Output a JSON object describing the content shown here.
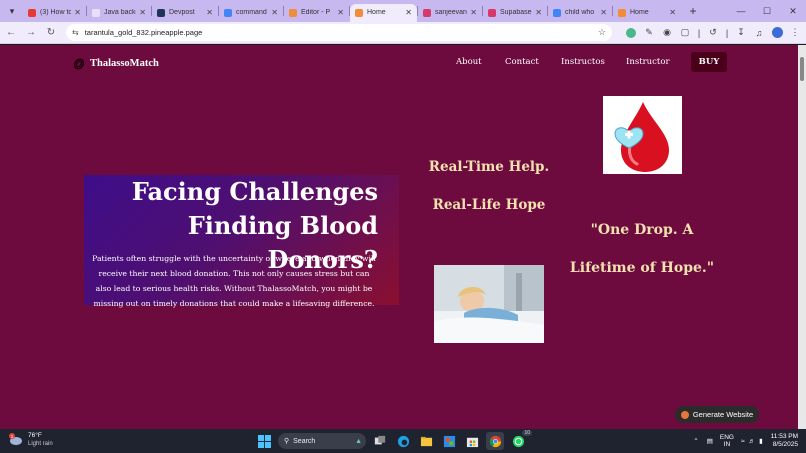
{
  "browser": {
    "tabs": [
      {
        "title": "(3) How to",
        "favicon_color": "#e53935",
        "active": false
      },
      {
        "title": "Java backe",
        "favicon_color": "#e8e0f8",
        "active": false
      },
      {
        "title": "Devpost",
        "favicon_color": "#1d3557",
        "active": false
      },
      {
        "title": "command",
        "favicon_color": "#4285f4",
        "active": false
      },
      {
        "title": "Editor - P",
        "favicon_color": "#f28c38",
        "active": false
      },
      {
        "title": "Home",
        "favicon_color": "#f28c38",
        "active": true
      },
      {
        "title": "sanjeevan",
        "favicon_color": "#d63a6a",
        "active": false
      },
      {
        "title": "Supabase",
        "favicon_color": "#d63a6a",
        "active": false
      },
      {
        "title": "child who",
        "favicon_color": "#4285f4",
        "active": false
      },
      {
        "title": "Home",
        "favicon_color": "#f28c38",
        "active": false
      }
    ],
    "url": "tarantula_gold_832.pineapple.page"
  },
  "site": {
    "brand": "ThalassoMatch",
    "nav": [
      "About",
      "Contact",
      "Instructos",
      "Instructor"
    ],
    "buy_label": "BUY",
    "hero_title": "Facing Challenges Finding Blood Donors?",
    "hero_text": "Patients often struggle with the uncertainty of where and when they will receive their next blood donation. This not only causes stress but can also lead to serious health risks. Without ThalassoMatch, you might be missing out on timely donations that could make a lifesaving difference.",
    "tagline_1": "Real-Time Help.",
    "tagline_2": "Real-Life Hope",
    "quote": "\"One Drop. A Lifetime of Hope.\"",
    "generate_label": "Generate Website",
    "colors": {
      "page_bg": "#6d0b3e",
      "accent_text": "#f3e2b0",
      "buy_bg": "#4a0019"
    }
  },
  "taskbar": {
    "weather_temp": "76°F",
    "weather_desc": "Light rain",
    "weather_badge": "1",
    "search_placeholder": "Search",
    "whatsapp_badge": "10",
    "lang_1": "ENG",
    "lang_2": "IN",
    "time": "11:53 PM",
    "date": "8/5/2025"
  }
}
